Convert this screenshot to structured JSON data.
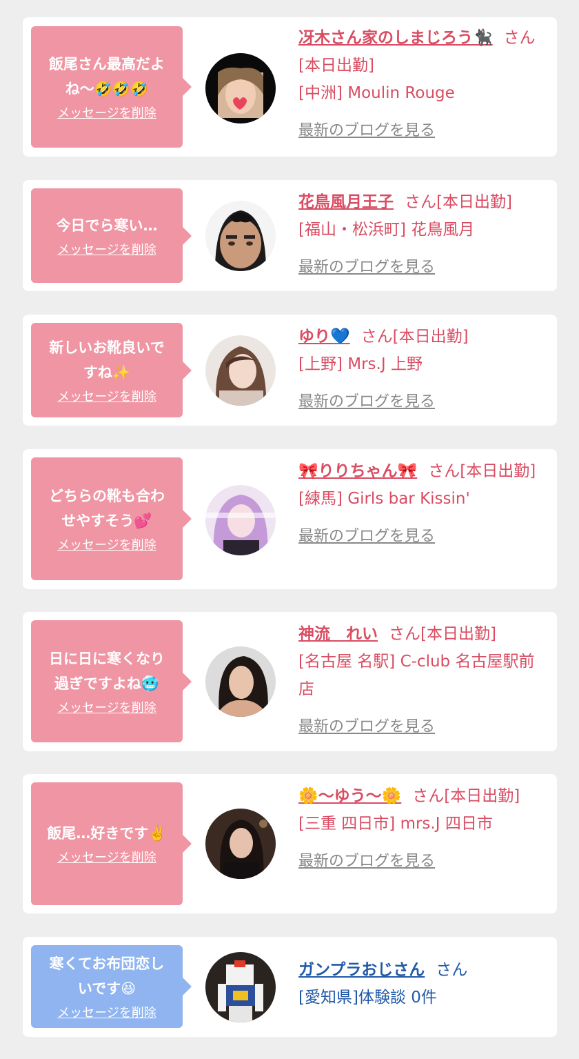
{
  "messages": [
    {
      "message": "飯尾さん最高だよ\nね〜🤣🤣🤣",
      "delete_label": "メッセージを削除",
      "name": "冴木さん家のしまじろう🐈‍⬛",
      "suffix": "さん[本日出勤]",
      "shop": "[中洲] Moulin Rouge",
      "blog_label": "最新のブログを見る",
      "avatar_icon": "avatar-photo",
      "theme": "pink"
    },
    {
      "message": "今日でら寒い…",
      "delete_label": "メッセージを削除",
      "name": "花鳥風月王子",
      "suffix": "さん[本日出勤]",
      "shop": "[福山・松浜町] 花鳥風月",
      "blog_label": "最新のブログを見る",
      "avatar_icon": "avatar-photo",
      "theme": "pink"
    },
    {
      "message": "新しいお靴良いで\nすね✨",
      "delete_label": "メッセージを削除",
      "name": "ゆり💙",
      "suffix": "さん[本日出勤]",
      "shop": "[上野] Mrs.J 上野",
      "blog_label": "最新のブログを見る",
      "avatar_icon": "avatar-photo",
      "theme": "pink"
    },
    {
      "message": "どちらの靴も合わ\nせやすそう💕",
      "delete_label": "メッセージを削除",
      "name": "🎀りりちゃん🎀",
      "suffix": "さん[本日出勤]",
      "shop": "[練馬] Girls bar Kissin'",
      "blog_label": "最新のブログを見る",
      "avatar_icon": "avatar-photo",
      "theme": "pink"
    },
    {
      "message": "日に日に寒くなり\n過ぎですよね🥶",
      "delete_label": "メッセージを削除",
      "name": "神流　れい",
      "suffix": "さん[本日出勤]",
      "shop": "[名古屋 名駅] C-club 名古屋駅前店",
      "blog_label": "最新のブログを見る",
      "avatar_icon": "avatar-photo",
      "theme": "pink"
    },
    {
      "message": "飯尾…好きです✌️",
      "delete_label": "メッセージを削除",
      "name": "🌼〜ゆう〜🌼",
      "suffix": "さん[本日出勤]",
      "shop": "[三重 四日市] mrs.J 四日市",
      "blog_label": "最新のブログを見る",
      "avatar_icon": "avatar-photo",
      "theme": "pink"
    },
    {
      "message": "寒くてお布団恋し\nいです😆",
      "delete_label": "メッセージを削除",
      "name": "ガンプラおじさん",
      "suffix": "さん",
      "shop": "[愛知県]体験談 0件",
      "blog_label": "",
      "avatar_icon": "avatar-photo",
      "theme": "blue"
    }
  ],
  "colors": {
    "background": "#eeeeee",
    "card": "#ffffff",
    "bubble_pink": "#ef95a3",
    "bubble_blue": "#8fb4f0",
    "name_pink": "#d94c62",
    "name_blue": "#2159a8",
    "link_gray": "#888888"
  }
}
